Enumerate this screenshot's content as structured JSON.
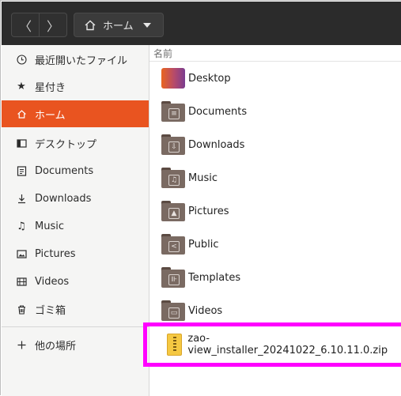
{
  "header": {
    "back_glyph": "〈",
    "forward_glyph": "〉",
    "path_label": "ホーム"
  },
  "sidebar": {
    "items": [
      {
        "label": "最近開いたファイル",
        "icon": "clock-icon"
      },
      {
        "label": "星付き",
        "icon": "star-icon"
      },
      {
        "label": "ホーム",
        "icon": "home-icon",
        "active": true
      },
      {
        "label": "デスクトップ",
        "icon": "desktop-icon"
      },
      {
        "label": "Documents",
        "icon": "document-icon"
      },
      {
        "label": "Downloads",
        "icon": "download-icon"
      },
      {
        "label": "Music",
        "icon": "music-icon"
      },
      {
        "label": "Pictures",
        "icon": "picture-icon"
      },
      {
        "label": "Videos",
        "icon": "video-icon"
      },
      {
        "label": "ゴミ箱",
        "icon": "trash-icon"
      }
    ],
    "other_locations": {
      "label": "他の場所",
      "icon": "plus-icon"
    }
  },
  "list": {
    "column_name": "名前",
    "rows": [
      {
        "name": "Desktop",
        "icon": "desktop-folder-icon"
      },
      {
        "name": "Documents",
        "icon": "documents-folder-icon"
      },
      {
        "name": "Downloads",
        "icon": "downloads-folder-icon"
      },
      {
        "name": "Music",
        "icon": "music-folder-icon"
      },
      {
        "name": "Pictures",
        "icon": "pictures-folder-icon"
      },
      {
        "name": "Public",
        "icon": "public-folder-icon"
      },
      {
        "name": "Templates",
        "icon": "templates-folder-icon"
      },
      {
        "name": "Videos",
        "icon": "videos-folder-icon"
      },
      {
        "name": "zao-view_installer_20241022_6.10.11.0.zip",
        "icon": "zip-archive-icon"
      }
    ]
  },
  "colors": {
    "accent": "#e95420",
    "highlight": "#ff00ff",
    "header_bg": "#2b2b2b"
  }
}
